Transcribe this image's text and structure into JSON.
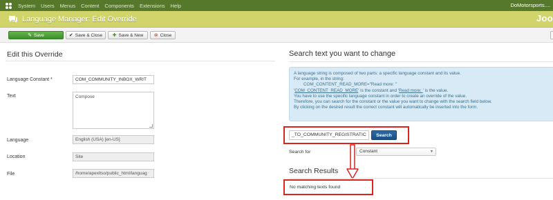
{
  "topnav": {
    "menu": [
      "System",
      "Users",
      "Menus",
      "Content",
      "Components",
      "Extensions",
      "Help"
    ],
    "site_name": "DoMotorsports...."
  },
  "header": {
    "title": "Language Manager: Edit Override",
    "brand": "Joo"
  },
  "toolbar": {
    "save": "Save",
    "save_close": "Save & Close",
    "save_new": "Save & New",
    "close": "Close"
  },
  "left": {
    "title": "Edit this Override",
    "constant_label": "Language Constant *",
    "constant_value": "COM_COMMUNITY_INBOX_WRIT",
    "text_label": "Text",
    "text_value": "Compose",
    "language_label": "Language",
    "language_value": "English (USA) [en-US]",
    "location_label": "Location",
    "location_value": "Site",
    "file_label": "File",
    "file_value": "/home/apexltso/public_html/languag"
  },
  "right": {
    "title": "Search text you want to change",
    "info": {
      "line1": "A language string is composed of two parts: a specific language constant and its value.",
      "line2": "For example, in the string:",
      "line3": "COM_CONTENT_READ_MORE=\"Read more: \"",
      "line4a": "'",
      "line4b": "COM_CONTENT_READ_MORE",
      "line4c": "' is the constant and '",
      "line4d": "Read more: ",
      "line4e": "' is the value.",
      "line5": "You have to use the specific language constant in order to create an override of the value.",
      "line6": "Therefore, you can search for the constant or the value you want to change with the search field below.",
      "line7": "By clicking on the desired result the correct constant will automatically be inserted into the form."
    },
    "search_value": "_TO_COMMUNITY_REGISTRATIC",
    "search_button": "Search",
    "search_for_label": "Search for",
    "search_for_value": "Constant",
    "results_title": "Search Results",
    "results_text": "No matching texts found"
  },
  "colors": {
    "topnav": "#56782b",
    "header": "#d0d46a",
    "highlight": "#d9231f",
    "search_button": "#1c4f85"
  }
}
